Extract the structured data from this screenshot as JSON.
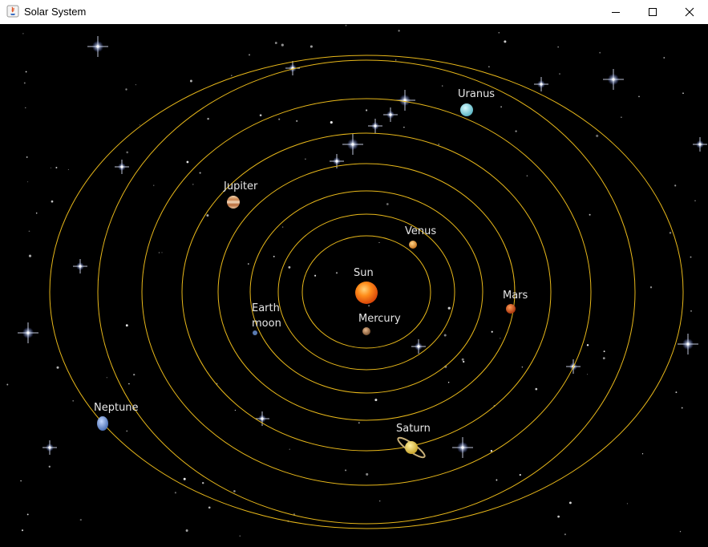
{
  "window": {
    "title": "Solar System",
    "icon": "java-app-icon",
    "controls": [
      "minimize-icon",
      "maximize-icon",
      "close-icon"
    ]
  },
  "orbit_color": "#e8b81a",
  "bodies": {
    "sun": "Sun",
    "mercury": "Mercury",
    "venus": "Venus",
    "earth_line1": "Earth",
    "earth_line2": "moon",
    "mars": "Mars",
    "jupiter": "Jupiter",
    "saturn": "Saturn",
    "uranus": "Uranus",
    "neptune": "Neptune"
  }
}
